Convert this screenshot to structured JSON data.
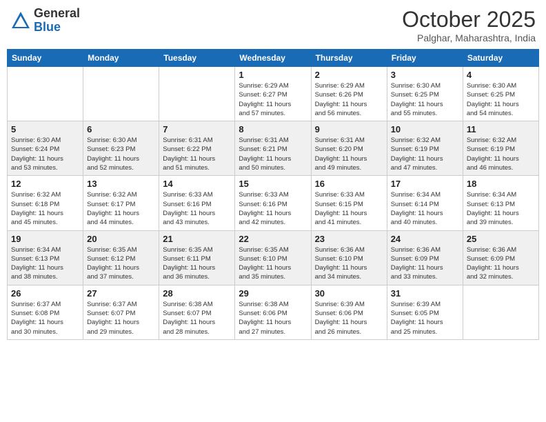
{
  "header": {
    "logo_general": "General",
    "logo_blue": "Blue",
    "month_title": "October 2025",
    "location": "Palghar, Maharashtra, India"
  },
  "days_of_week": [
    "Sunday",
    "Monday",
    "Tuesday",
    "Wednesday",
    "Thursday",
    "Friday",
    "Saturday"
  ],
  "weeks": [
    [
      {
        "day": "",
        "info": ""
      },
      {
        "day": "",
        "info": ""
      },
      {
        "day": "",
        "info": ""
      },
      {
        "day": "1",
        "info": "Sunrise: 6:29 AM\nSunset: 6:27 PM\nDaylight: 11 hours\nand 57 minutes."
      },
      {
        "day": "2",
        "info": "Sunrise: 6:29 AM\nSunset: 6:26 PM\nDaylight: 11 hours\nand 56 minutes."
      },
      {
        "day": "3",
        "info": "Sunrise: 6:30 AM\nSunset: 6:25 PM\nDaylight: 11 hours\nand 55 minutes."
      },
      {
        "day": "4",
        "info": "Sunrise: 6:30 AM\nSunset: 6:25 PM\nDaylight: 11 hours\nand 54 minutes."
      }
    ],
    [
      {
        "day": "5",
        "info": "Sunrise: 6:30 AM\nSunset: 6:24 PM\nDaylight: 11 hours\nand 53 minutes."
      },
      {
        "day": "6",
        "info": "Sunrise: 6:30 AM\nSunset: 6:23 PM\nDaylight: 11 hours\nand 52 minutes."
      },
      {
        "day": "7",
        "info": "Sunrise: 6:31 AM\nSunset: 6:22 PM\nDaylight: 11 hours\nand 51 minutes."
      },
      {
        "day": "8",
        "info": "Sunrise: 6:31 AM\nSunset: 6:21 PM\nDaylight: 11 hours\nand 50 minutes."
      },
      {
        "day": "9",
        "info": "Sunrise: 6:31 AM\nSunset: 6:20 PM\nDaylight: 11 hours\nand 49 minutes."
      },
      {
        "day": "10",
        "info": "Sunrise: 6:32 AM\nSunset: 6:19 PM\nDaylight: 11 hours\nand 47 minutes."
      },
      {
        "day": "11",
        "info": "Sunrise: 6:32 AM\nSunset: 6:19 PM\nDaylight: 11 hours\nand 46 minutes."
      }
    ],
    [
      {
        "day": "12",
        "info": "Sunrise: 6:32 AM\nSunset: 6:18 PM\nDaylight: 11 hours\nand 45 minutes."
      },
      {
        "day": "13",
        "info": "Sunrise: 6:32 AM\nSunset: 6:17 PM\nDaylight: 11 hours\nand 44 minutes."
      },
      {
        "day": "14",
        "info": "Sunrise: 6:33 AM\nSunset: 6:16 PM\nDaylight: 11 hours\nand 43 minutes."
      },
      {
        "day": "15",
        "info": "Sunrise: 6:33 AM\nSunset: 6:16 PM\nDaylight: 11 hours\nand 42 minutes."
      },
      {
        "day": "16",
        "info": "Sunrise: 6:33 AM\nSunset: 6:15 PM\nDaylight: 11 hours\nand 41 minutes."
      },
      {
        "day": "17",
        "info": "Sunrise: 6:34 AM\nSunset: 6:14 PM\nDaylight: 11 hours\nand 40 minutes."
      },
      {
        "day": "18",
        "info": "Sunrise: 6:34 AM\nSunset: 6:13 PM\nDaylight: 11 hours\nand 39 minutes."
      }
    ],
    [
      {
        "day": "19",
        "info": "Sunrise: 6:34 AM\nSunset: 6:13 PM\nDaylight: 11 hours\nand 38 minutes."
      },
      {
        "day": "20",
        "info": "Sunrise: 6:35 AM\nSunset: 6:12 PM\nDaylight: 11 hours\nand 37 minutes."
      },
      {
        "day": "21",
        "info": "Sunrise: 6:35 AM\nSunset: 6:11 PM\nDaylight: 11 hours\nand 36 minutes."
      },
      {
        "day": "22",
        "info": "Sunrise: 6:35 AM\nSunset: 6:10 PM\nDaylight: 11 hours\nand 35 minutes."
      },
      {
        "day": "23",
        "info": "Sunrise: 6:36 AM\nSunset: 6:10 PM\nDaylight: 11 hours\nand 34 minutes."
      },
      {
        "day": "24",
        "info": "Sunrise: 6:36 AM\nSunset: 6:09 PM\nDaylight: 11 hours\nand 33 minutes."
      },
      {
        "day": "25",
        "info": "Sunrise: 6:36 AM\nSunset: 6:09 PM\nDaylight: 11 hours\nand 32 minutes."
      }
    ],
    [
      {
        "day": "26",
        "info": "Sunrise: 6:37 AM\nSunset: 6:08 PM\nDaylight: 11 hours\nand 30 minutes."
      },
      {
        "day": "27",
        "info": "Sunrise: 6:37 AM\nSunset: 6:07 PM\nDaylight: 11 hours\nand 29 minutes."
      },
      {
        "day": "28",
        "info": "Sunrise: 6:38 AM\nSunset: 6:07 PM\nDaylight: 11 hours\nand 28 minutes."
      },
      {
        "day": "29",
        "info": "Sunrise: 6:38 AM\nSunset: 6:06 PM\nDaylight: 11 hours\nand 27 minutes."
      },
      {
        "day": "30",
        "info": "Sunrise: 6:39 AM\nSunset: 6:06 PM\nDaylight: 11 hours\nand 26 minutes."
      },
      {
        "day": "31",
        "info": "Sunrise: 6:39 AM\nSunset: 6:05 PM\nDaylight: 11 hours\nand 25 minutes."
      },
      {
        "day": "",
        "info": ""
      }
    ]
  ],
  "row_bg": [
    "#fff",
    "#f0f0f0",
    "#fff",
    "#f0f0f0",
    "#fff"
  ]
}
